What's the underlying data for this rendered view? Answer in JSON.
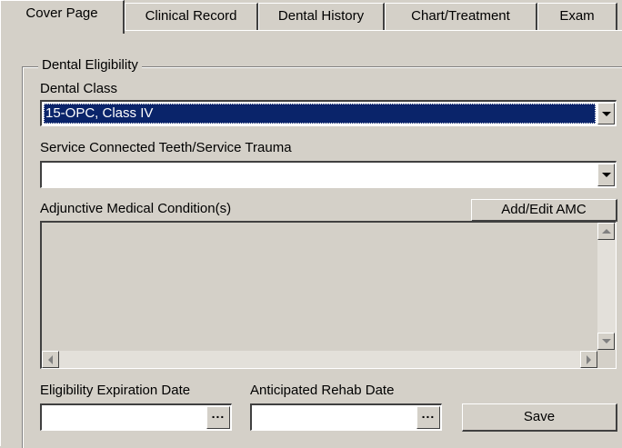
{
  "tabs": [
    "Cover Page",
    "Clinical Record",
    "Dental History",
    "Chart/Treatment",
    "Exam"
  ],
  "active_tab": "Cover Page",
  "group": {
    "title": "Dental Eligibility",
    "dental_class": {
      "label": "Dental Class",
      "value": "15-OPC, Class IV"
    },
    "service_connected": {
      "label": "Service Connected Teeth/Service Trauma",
      "value": ""
    },
    "amc": {
      "label": "Adjunctive Medical Condition(s)",
      "button": "Add/Edit AMC"
    },
    "eligibility_expiration": {
      "label": "Eligibility Expiration Date",
      "value": "",
      "button": "..."
    },
    "anticipated_rehab": {
      "label": "Anticipated Rehab Date",
      "value": "",
      "button": "..."
    },
    "save_button": "Save"
  },
  "colors": {
    "face": "#d4d0c8",
    "selection": "#0a246a",
    "shadow": "#404040"
  }
}
